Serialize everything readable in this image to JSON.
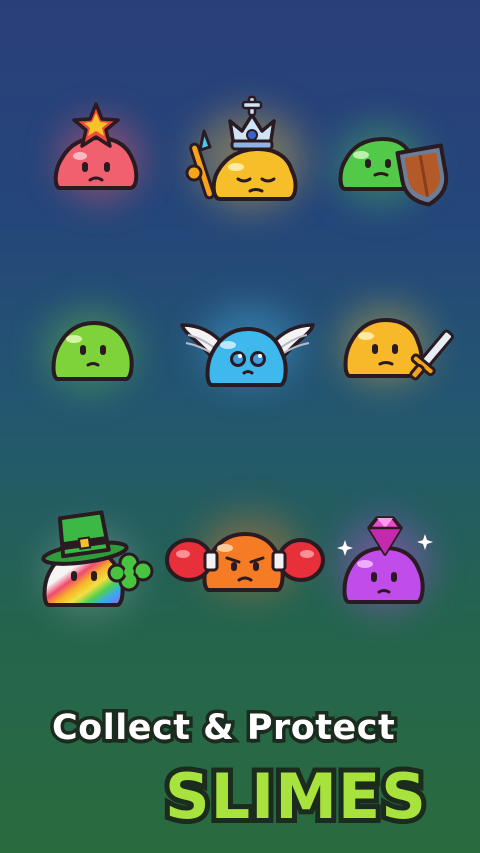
{
  "promo": {
    "tagline": "Collect & Protect",
    "headline": "SLIMES"
  },
  "slimes": [
    {
      "name": "red slime with star",
      "color": "#f0606e",
      "accessory": "star-icon"
    },
    {
      "name": "yellow king slime",
      "color": "#f6bf2a",
      "accessory": "crown-icon"
    },
    {
      "name": "green slime with shield",
      "color": "#53c94a",
      "accessory": "shield-icon"
    },
    {
      "name": "lime slime",
      "color": "#7ed23a",
      "accessory": "none"
    },
    {
      "name": "blue winged slime",
      "color": "#3fb8ee",
      "accessory": "wings-icon"
    },
    {
      "name": "yellow slime with sword",
      "color": "#f7b82a",
      "accessory": "sword-icon"
    },
    {
      "name": "rainbow slime with hat and clover",
      "color": "#f2f2f2",
      "accessory": "clover-icon"
    },
    {
      "name": "orange boxer slime",
      "color": "#f57b24",
      "accessory": "boxing-glove-icon"
    },
    {
      "name": "purple gem slime",
      "color": "#c04cea",
      "accessory": "gem-icon"
    }
  ]
}
